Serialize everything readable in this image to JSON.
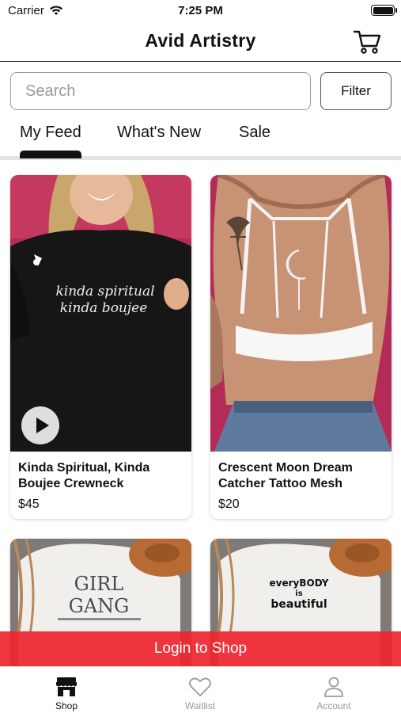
{
  "status_bar": {
    "carrier": "Carrier",
    "time": "7:25 PM"
  },
  "header": {
    "title": "Avid Artistry",
    "cart_icon": "shopping-cart-icon"
  },
  "search": {
    "placeholder": "Search",
    "value": ""
  },
  "filter_label": "Filter",
  "tabs": [
    {
      "label": "My Feed",
      "active": true
    },
    {
      "label": "What's New",
      "active": false
    },
    {
      "label": "Sale",
      "active": false
    }
  ],
  "products": [
    {
      "name": "Kinda Spiritual, Kinda Boujee Crewneck",
      "price": "$45",
      "has_video": true,
      "print_text": [
        "kinda spiritual",
        "kinda boujee"
      ]
    },
    {
      "name": "Crescent Moon Dream Catcher Tattoo Mesh",
      "price": "$20",
      "has_video": false
    },
    {
      "name": "",
      "price": "",
      "print_text": [
        "GIRL",
        "GANG"
      ]
    },
    {
      "name": "",
      "price": "",
      "print_text": [
        "everyBODY",
        "is",
        "beautiful"
      ]
    }
  ],
  "login_bar": {
    "label": "Login to Shop"
  },
  "tab_bar": [
    {
      "label": "Shop",
      "icon": "storefront-icon",
      "active": true
    },
    {
      "label": "Waitlist",
      "icon": "heart-icon",
      "active": false
    },
    {
      "label": "Account",
      "icon": "person-icon",
      "active": false
    }
  ],
  "colors": {
    "accent": "#ee262e",
    "active_tab": "#111111",
    "inactive_tab": "#9a9a9a"
  }
}
